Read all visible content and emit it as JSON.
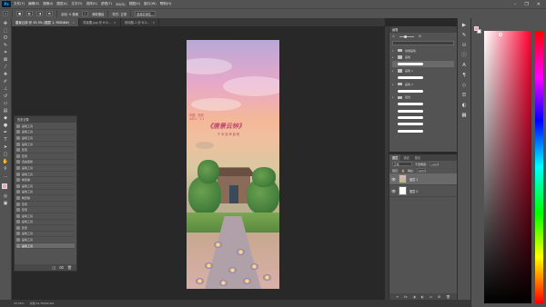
{
  "menubar": {
    "app_badge": "Ps",
    "items": [
      "文件(F)",
      "编辑(E)",
      "图像(I)",
      "图层(L)",
      "文字(Y)",
      "选择(S)",
      "滤镜(T)",
      "3D(D)",
      "视图(V)",
      "窗口(W)",
      "帮助(H)"
    ]
  },
  "optionsbar": {
    "feather_label": "羽化: 0 像素",
    "antialias_label": "消除锯齿",
    "style_label": "样式: 正常",
    "select_mask_label": "选择并遮住..."
  },
  "tabs": [
    {
      "label": "唐景云钟 @ 33.3% (图层 1, RGB/8#)"
    },
    {
      "label": "背景图.jpg @ 6.6..."
    },
    {
      "label": "未标题-1 @ 8.3..."
    }
  ],
  "artwork": {
    "seal_red": "中国 · 西安",
    "seal_red2": "2021 · 1.1",
    "title": "《唐景云钟》",
    "subtitle": "千 年 钟 声 回 响"
  },
  "history": {
    "title": "历史记录",
    "items": [
      "画笔工具",
      "画笔工具",
      "画笔工具",
      "画笔工具",
      "套索",
      "套索",
      "自由变换",
      "画笔工具",
      "画笔工具",
      "橡皮擦",
      "画笔工具",
      "画笔工具",
      "橡皮擦",
      "套索",
      "套索",
      "画笔工具",
      "画笔工具",
      "套索",
      "画笔工具",
      "画笔工具",
      "画笔工具"
    ],
    "selected_index": 20
  },
  "brushes": {
    "title": "画笔",
    "group_label": "常规画笔",
    "rows": [
      {
        "label": "画笔",
        "type": "folder"
      },
      {
        "label": "",
        "type": "stroke"
      },
      {
        "label": "画笔 1",
        "type": "folder"
      },
      {
        "label": "",
        "type": "stroke"
      },
      {
        "label": "画笔 2",
        "type": "folder"
      },
      {
        "label": "",
        "type": "stroke"
      },
      {
        "label": "组合",
        "type": "folder"
      },
      {
        "label": "",
        "type": "stroke"
      },
      {
        "label": "",
        "type": "stroke"
      },
      {
        "label": "",
        "type": "stroke"
      },
      {
        "label": "",
        "type": "stroke"
      },
      {
        "label": "",
        "type": "stroke"
      }
    ]
  },
  "layers": {
    "tabs": [
      "图层",
      "通道",
      "路径"
    ],
    "blend_mode": "正常",
    "opacity_label": "不透明度:",
    "opacity_value": "100%",
    "lock_label": "锁定:",
    "fill_label": "填充:",
    "fill_value": "100%",
    "items": [
      {
        "name": "图层 1",
        "selected": true,
        "thumb": "art"
      },
      {
        "name": "图层 0",
        "selected": false,
        "thumb": "blank"
      }
    ]
  },
  "status": {
    "zoom": "33.33%",
    "doc_info": "文档:14.7M/29.4M"
  },
  "colors": {
    "foreground": "#f0a0b8",
    "background": "#ffffff"
  }
}
